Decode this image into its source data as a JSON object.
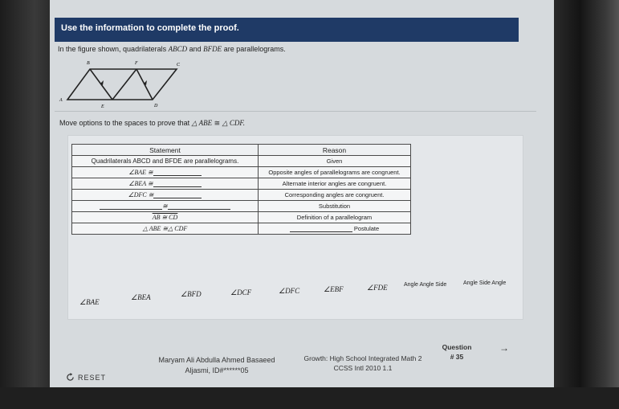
{
  "header": {
    "title": "Use the information to complete the proof."
  },
  "intro": {
    "prefix": "In the figure shown, quadrilaterals",
    "quad1": "ABCD",
    "mid": "and",
    "quad2": "BFDE",
    "suffix": "are parallelograms."
  },
  "figure": {
    "labels": {
      "B": "B",
      "F": "F",
      "C": "C",
      "A": "A",
      "E": "E",
      "D": "D"
    }
  },
  "prompt": {
    "text": "Move options to the spaces to prove that",
    "tri1": "△ ABE",
    "cong": "≅",
    "tri2": "△ CDF."
  },
  "table": {
    "headers": {
      "statement": "Statement",
      "reason": "Reason"
    },
    "rows": [
      {
        "statement": "Quadrilaterals ABCD and BFDE are parallelograms.",
        "reason": "Given"
      },
      {
        "statement": "∠BAE ≅",
        "reason": "Opposite angles of parallelograms are congruent."
      },
      {
        "statement": "∠BEA ≅",
        "reason": "Alternate interior angles are congruent."
      },
      {
        "statement": "∠DFC ≅",
        "reason": "Corresponding angles are congruent."
      },
      {
        "statement": "≅",
        "reason": "Substitution"
      },
      {
        "statement": "AB ≅ CD",
        "reason": "Definition of a parallelogram"
      },
      {
        "statement": "△ ABE ≅△ CDF",
        "reason": "Postulate"
      }
    ]
  },
  "options": [
    "∠BAE",
    "∠BEA",
    "∠BFD",
    "∠DCF",
    "∠DFC",
    "∠EBF",
    "∠FDE",
    "Angle Angle Side",
    "Angle Side Angle"
  ],
  "footer": {
    "reset": "RESET",
    "student_name": "Maryam Ali Abdulla Ahmed Basaeed",
    "student_id": "Aljasmi, ID#******05",
    "course": "Growth: High School Integrated Math 2",
    "standard": "CCSS Intl 2010 1.1",
    "question_label": "Question",
    "question_number": "# 35",
    "next_arrow": "→"
  },
  "colors": {
    "header_bg": "#1f3a66",
    "screen_bg": "#d6dadd",
    "panel_bg": "#e4e7ea"
  }
}
